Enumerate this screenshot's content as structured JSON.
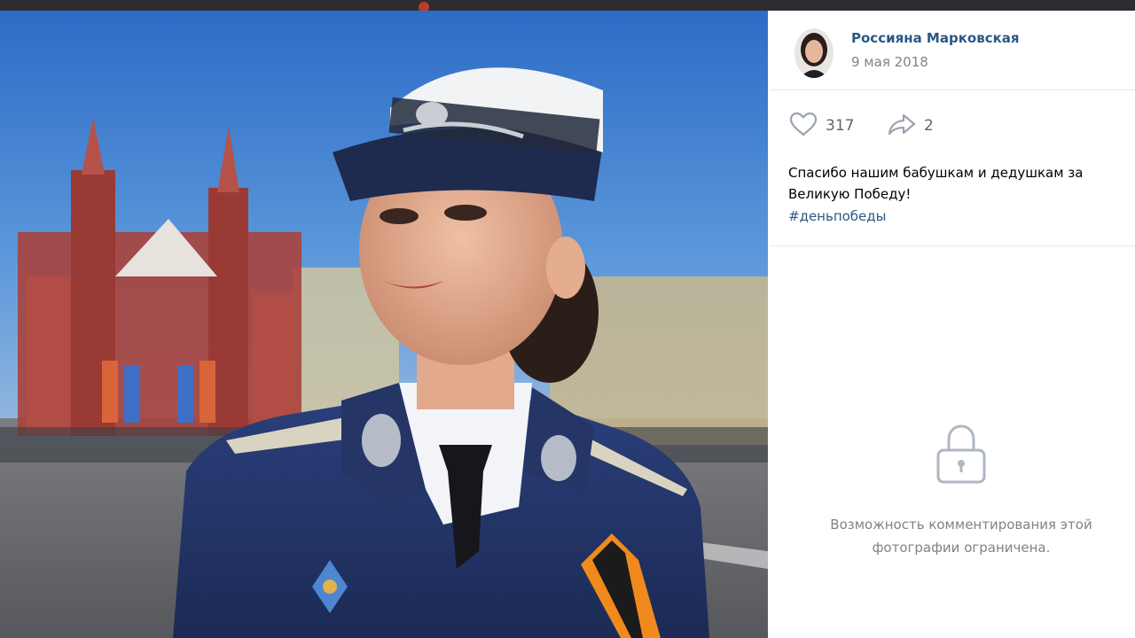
{
  "post": {
    "author_name": "Россияна Марковская",
    "date": "9 мая 2018",
    "likes_count": "317",
    "shares_count": "2",
    "text": "Спасибо нашим бабушкам и дедушкам за Великую Победу!",
    "hashtag": "#деньпобеды"
  },
  "comments": {
    "restricted_text": "Возможность комментирования этой фотографии ограничена."
  },
  "icons": {
    "like": "heart-icon",
    "share": "share-arrow-icon",
    "lock": "lock-icon"
  },
  "colors": {
    "link": "#2a5885",
    "muted": "#828282",
    "counter": "#656565",
    "divider": "#e7e8ec"
  }
}
